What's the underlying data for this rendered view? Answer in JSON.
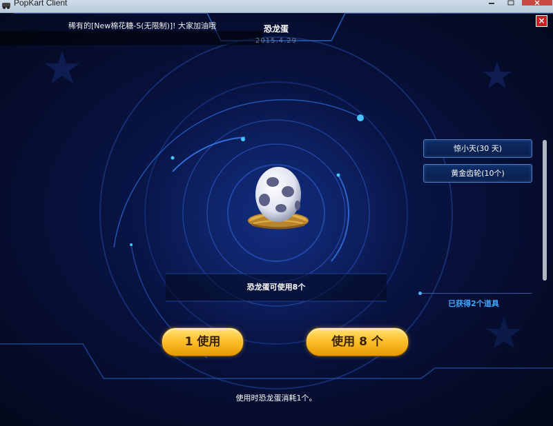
{
  "window": {
    "title": "PopKart Client"
  },
  "popup": {
    "ticker_text": "稀有的[New棉花糖-S(无限制)]! 大家加油哦",
    "title": "恐龙蛋",
    "date": "2015.4.29",
    "close_label": "×",
    "item_icon": "dinosaur-egg-in-nest",
    "usable_text": "恐龙蛋可使用8个",
    "rewards": [
      {
        "label": "惊小天(30 天)"
      },
      {
        "label": "黄金齿轮(10个)"
      }
    ],
    "obtained_text": "已获得2个道具",
    "use_one_label": "1 使用",
    "use_all_label": "使用 8 个",
    "footer_text": "使用时恐龙蛋消耗1个。"
  },
  "colors": {
    "background": "#060d2f",
    "accent_blue": "#3ea7ff",
    "button_gold": "#fcc12c",
    "close_red": "#c62020"
  }
}
